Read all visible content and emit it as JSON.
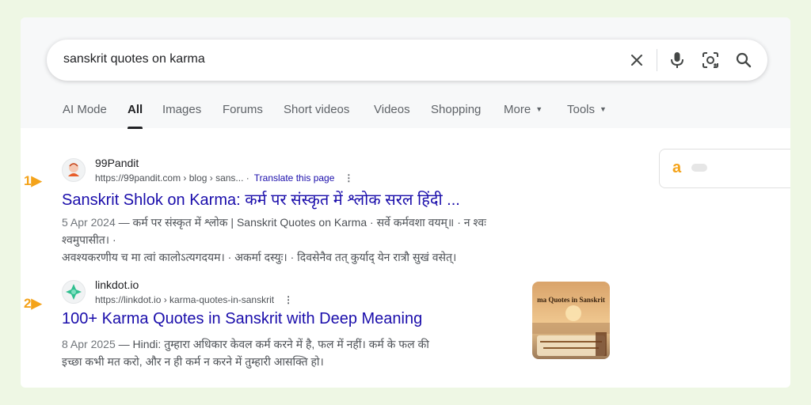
{
  "search": {
    "query": "sanskrit quotes on karma",
    "icons": [
      "close-icon",
      "mic-icon",
      "lens-icon",
      "search-icon"
    ]
  },
  "tabs": [
    {
      "label": "AI Mode"
    },
    {
      "label": "All"
    },
    {
      "label": "Images"
    },
    {
      "label": "Forums"
    },
    {
      "label": "Short videos"
    },
    {
      "label": "Videos"
    },
    {
      "label": "Shopping"
    },
    {
      "label": "More"
    },
    {
      "label": "Tools"
    }
  ],
  "active_tab": "All",
  "markers": [
    "1",
    "2"
  ],
  "results": [
    {
      "site_name": "99Pandit",
      "url": "https://99pandit.com › blog › sans...",
      "translate": "Translate this page",
      "title": "Sanskrit Shlok on Karma: कर्म पर संस्कृत में श्लोक सरल हिंदी ...",
      "date": "5 Apr 2024",
      "snippet_line1": " — कर्म पर संस्कृत में श्लोक | Sanskrit Quotes on Karma · सर्वे कर्मवशा वयम्॥ · न श्वः श्वमुपासीत। ·",
      "snippet_line2": "अवश्यकरणीय च मा त्वां कालोऽत्यगदयम। · अकर्मा दस्युः। · दिवसेनैव तत् कुर्याद् येन रात्रौ सुखं वसेत्।"
    },
    {
      "site_name": "linkdot.io",
      "url": "https://linkdot.io › karma-quotes-in-sanskrit",
      "title": "100+ Karma Quotes in Sanskrit with Deep Meaning",
      "date": "8 Apr 2025",
      "snippet_line1": " — Hindi: तुम्हारा अधिकार केवल कर्म करने में है, फल में नहीं। कर्म के फल की",
      "snippet_line2": "इच्छा कभी मत करो, और न ही कर्म न करने में तुम्हारी आसक्ति हो।",
      "thumbnail_title": "ma Quotes in Sanskrit"
    }
  ],
  "side_card": {
    "letter": "a"
  },
  "colors": {
    "link": "#1a0dab",
    "marker": "#f4a31a",
    "background": "#eef7e4"
  }
}
